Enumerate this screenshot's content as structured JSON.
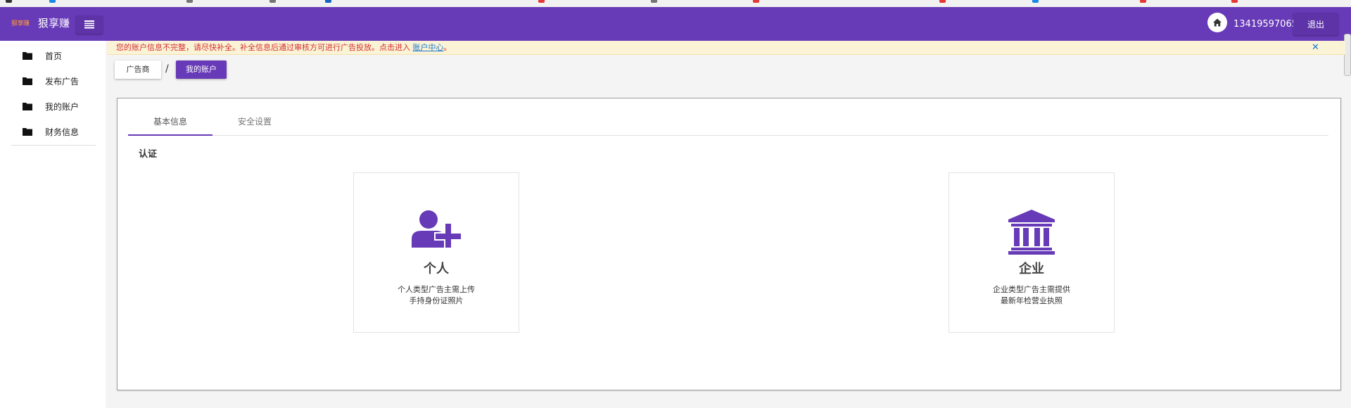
{
  "header": {
    "logo_text": "狠享赚",
    "app_title": "狠享赚",
    "menu_icon": "hamburger-icon",
    "home_icon": "home-icon",
    "phone": "13419597065",
    "logout_label": "退出",
    "brand_color": "#673ab7"
  },
  "sidebar": {
    "items": [
      {
        "label": "首页",
        "icon": "folder-icon"
      },
      {
        "label": "发布广告",
        "icon": "folder-icon"
      },
      {
        "label": "我的账户",
        "icon": "folder-icon"
      },
      {
        "label": "财务信息",
        "icon": "folder-icon"
      }
    ]
  },
  "alert": {
    "message": "您的账户信息不完整，请尽快补全。补全信息后通过审核方可进行广告投放。点击进入",
    "link_text": "账户中心",
    "suffix": "。",
    "close_icon": "close-icon",
    "text_color": "#d32f2f"
  },
  "breadcrumb": {
    "items": [
      "广告商",
      "我的账户"
    ],
    "separator": "/"
  },
  "tabs": [
    {
      "label": "基本信息",
      "active": true
    },
    {
      "label": "安全设置",
      "active": false
    }
  ],
  "section_title": "认证",
  "cards": [
    {
      "title": "个人",
      "icon": "user-plus-icon",
      "desc_line1": "个人类型广告主需上传",
      "desc_line2": "手持身份证照片"
    },
    {
      "title": "企业",
      "icon": "bank-icon",
      "desc_line1": "企业类型广告主需提供",
      "desc_line2": "最新年检营业执照"
    }
  ]
}
